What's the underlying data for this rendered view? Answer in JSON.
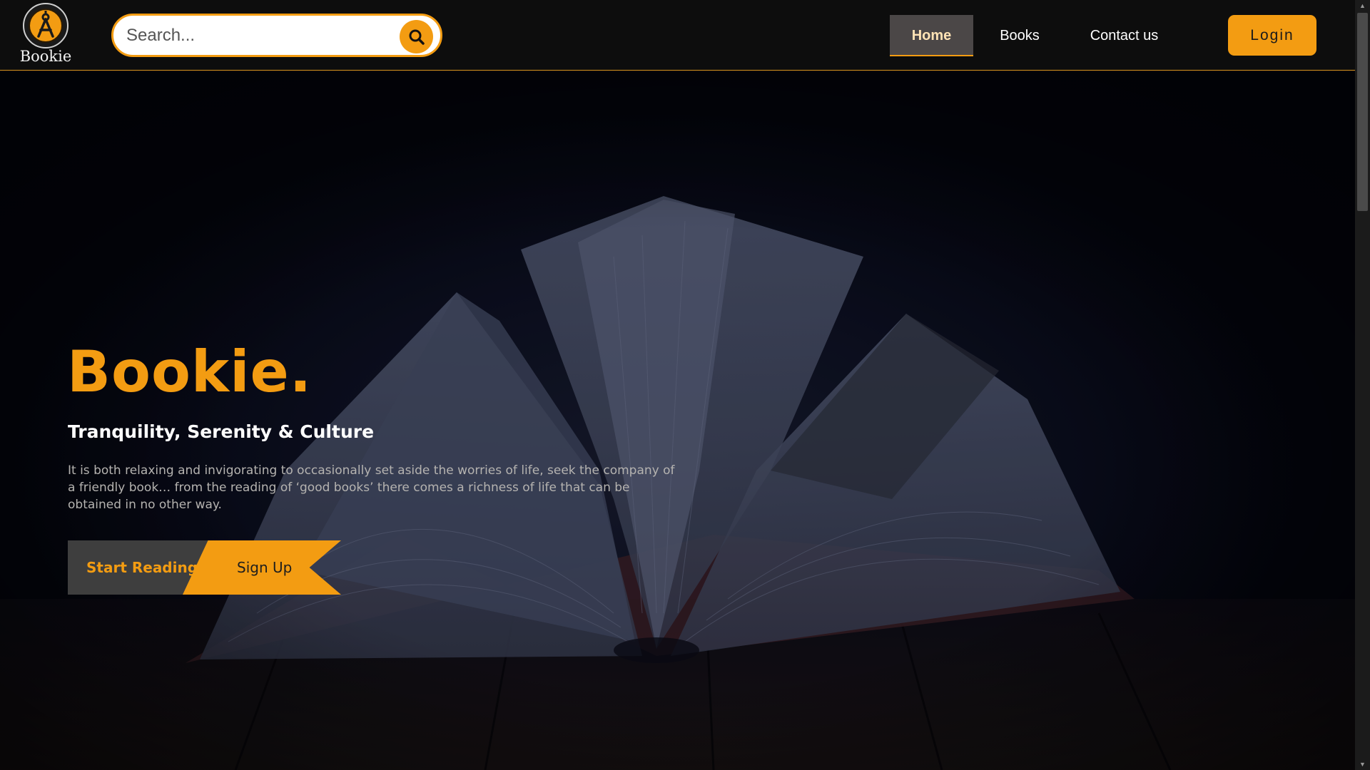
{
  "brand": {
    "name": "Bookie",
    "logo_icon": "compass-icon",
    "logo_color": "#f39c12"
  },
  "search": {
    "placeholder": "Search...",
    "value": "",
    "icon": "search-icon"
  },
  "nav": {
    "items": [
      {
        "label": "Home",
        "active": true
      },
      {
        "label": "Books",
        "active": false
      },
      {
        "label": "Contact us",
        "active": false
      }
    ],
    "login_label": "Login"
  },
  "hero": {
    "title": "Bookie.",
    "subtitle": "Tranquility, Serenity & Culture",
    "description": "It is both relaxing and invigorating to occasionally set aside the worries of life, seek the company of a friendly book… from the reading of ‘good books’ there comes a richness of life that can be obtained in no other way.",
    "primary_button": "Start Reading",
    "secondary_button": "Sign Up",
    "background_image": "open-book-photo"
  },
  "colors": {
    "accent": "#f39c12",
    "navbar_bg": "#0d0d0d",
    "hero_bg": "#05060f",
    "active_nav_bg": "#4b4747"
  }
}
